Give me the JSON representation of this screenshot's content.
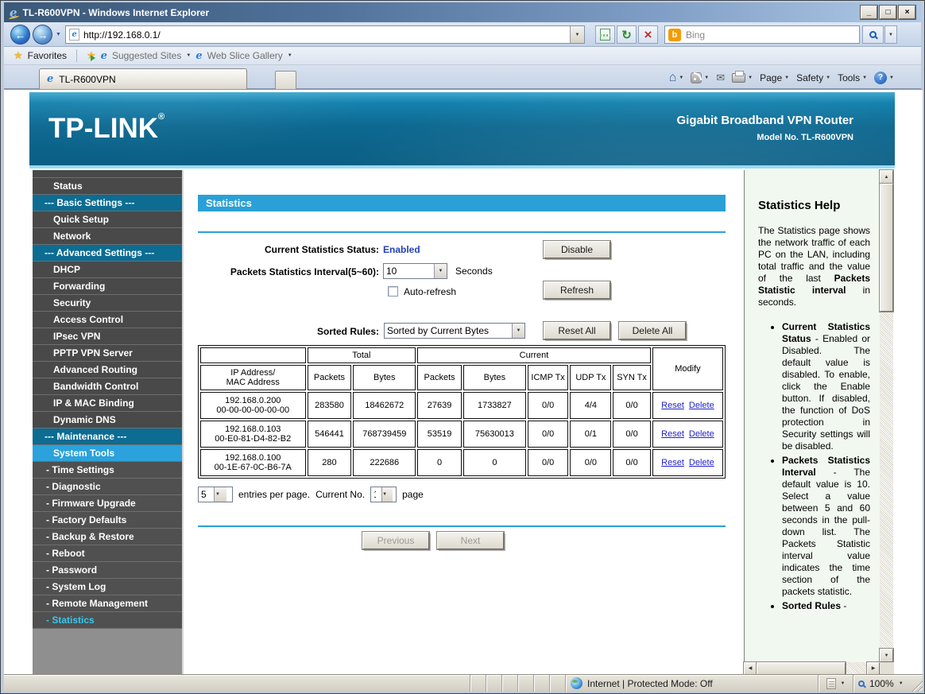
{
  "window": {
    "title": "TL-R600VPN - Windows Internet Explorer"
  },
  "browser": {
    "url": "http://192.168.0.1/",
    "search_text": "Bing",
    "favorites_label": "Favorites",
    "suggested_sites_label": "Suggested Sites",
    "web_slice_label": "Web Slice Gallery",
    "tab_title": "TL-R600VPN",
    "page_menu": "Page",
    "safety_menu": "Safety",
    "tools_menu": "Tools",
    "status_zone": "Internet | Protected Mode: Off",
    "zoom_level": "100%"
  },
  "header": {
    "logo": "TP-LINK",
    "reg": "®",
    "product": "Gigabit Broadband VPN Router",
    "model": "Model No. TL-R600VPN"
  },
  "sidebar": {
    "items": [
      {
        "label": "Status",
        "type": "item"
      },
      {
        "label": "--- Basic Settings ---",
        "type": "section"
      },
      {
        "label": "Quick Setup",
        "type": "item"
      },
      {
        "label": "Network",
        "type": "item"
      },
      {
        "label": "--- Advanced Settings ---",
        "type": "section"
      },
      {
        "label": "DHCP",
        "type": "item"
      },
      {
        "label": "Forwarding",
        "type": "item"
      },
      {
        "label": "Security",
        "type": "item"
      },
      {
        "label": "Access Control",
        "type": "item"
      },
      {
        "label": "IPsec VPN",
        "type": "item"
      },
      {
        "label": "PPTP VPN Server",
        "type": "item"
      },
      {
        "label": "Advanced Routing",
        "type": "item"
      },
      {
        "label": "Bandwidth Control",
        "type": "item"
      },
      {
        "label": "IP & MAC Binding",
        "type": "item"
      },
      {
        "label": "Dynamic DNS",
        "type": "item"
      },
      {
        "label": "--- Maintenance ---",
        "type": "section"
      },
      {
        "label": "System Tools",
        "type": "selected"
      },
      {
        "label": "- Time Settings",
        "type": "sub"
      },
      {
        "label": "- Diagnostic",
        "type": "sub"
      },
      {
        "label": "- Firmware Upgrade",
        "type": "sub"
      },
      {
        "label": "- Factory Defaults",
        "type": "sub"
      },
      {
        "label": "- Backup & Restore",
        "type": "sub"
      },
      {
        "label": "- Reboot",
        "type": "sub"
      },
      {
        "label": "- Password",
        "type": "sub"
      },
      {
        "label": "- System Log",
        "type": "sub"
      },
      {
        "label": "- Remote Management",
        "type": "sub"
      },
      {
        "label": "- Statistics",
        "type": "subsel"
      }
    ]
  },
  "main": {
    "page_title": "Statistics",
    "status_label": "Current Statistics Status:",
    "status_value": "Enabled",
    "disable_button": "Disable",
    "interval_label": "Packets Statistics Interval(5~60):",
    "interval_value": "10",
    "seconds_label": "Seconds",
    "autorefresh_label": "Auto-refresh",
    "refresh_button": "Refresh",
    "sorted_label": "Sorted Rules:",
    "sorted_value": "Sorted by Current Bytes",
    "reset_all_button": "Reset All",
    "delete_all_button": "Delete All",
    "table": {
      "ip_header_line1": "IP Address/",
      "ip_header_line2": "MAC Address",
      "total_header": "Total",
      "current_header": "Current",
      "modify_header": "Modify",
      "subheaders": [
        "Packets",
        "Bytes",
        "Packets",
        "Bytes",
        "ICMP Tx",
        "UDP Tx",
        "SYN Tx"
      ],
      "rows": [
        {
          "ip": "192.168.0.200",
          "mac": "00-00-00-00-00-00",
          "tp": "283580",
          "tb": "18462672",
          "cp": "27639",
          "cb": "1733827",
          "icmp": "0/0",
          "udp": "4/4",
          "syn": "0/0",
          "reset": "Reset",
          "del": "Delete"
        },
        {
          "ip": "192.168.0.103",
          "mac": "00-E0-81-D4-82-B2",
          "tp": "546441",
          "tb": "768739459",
          "cp": "53519",
          "cb": "75630013",
          "icmp": "0/0",
          "udp": "0/1",
          "syn": "0/0",
          "reset": "Reset",
          "del": "Delete"
        },
        {
          "ip": "192.168.0.100",
          "mac": "00-1E-67-0C-B6-7A",
          "tp": "280",
          "tb": "222686",
          "cp": "0",
          "cb": "0",
          "icmp": "0/0",
          "udp": "0/0",
          "syn": "0/0",
          "reset": "Reset",
          "del": "Delete"
        }
      ]
    },
    "entries_value": "5",
    "entries_label": "entries per page.",
    "current_no_label": "Current No.",
    "page_value": "1",
    "page_label": "page",
    "previous_button": "Previous",
    "next_button": "Next"
  },
  "help": {
    "title": "Statistics Help",
    "intro_1": "The Statistics page shows the network traffic of each PC on the LAN, including total traffic and the value of the last ",
    "intro_bold": "Packets Statistic interval",
    "intro_2": " in seconds.",
    "bullets": [
      {
        "bold": "Current Statistics Status",
        "text": " - Enabled or Disabled. The default value is disabled. To enable, click the Enable button. If disabled, the function of DoS protection in Security settings will be disabled."
      },
      {
        "bold": "Packets Statistics Interval",
        "text": " - The default value is 10. Select a value between 5 and 60 seconds in the pull-down list. The Packets Statistic interval value indicates the time section of the packets statistic."
      },
      {
        "bold": "Sorted Rules",
        "text": " -"
      }
    ]
  },
  "icons": {
    "caret": "▼",
    "up": "▲",
    "left": "◀",
    "right": "▶",
    "star": "★",
    "e": "e",
    "b": "b",
    "back": "←",
    "forward": "→",
    "stop": "×",
    "refresh": "↻",
    "home": "⌂",
    "mail": "✉",
    "help": "?",
    "minimize": "_",
    "maximize": "□",
    "close": "×"
  },
  "colors": {
    "accent_blue": "#2AA0D6",
    "section_blue": "#0C6C92",
    "selected_item_blue": "#2BA2DB",
    "selected_text_cyan": "#35C8F0",
    "link_blue": "#2222CC",
    "enabled_blue": "#2441B5",
    "help_bg": "#F1F8EF",
    "sidebar_gray": "#494949"
  }
}
